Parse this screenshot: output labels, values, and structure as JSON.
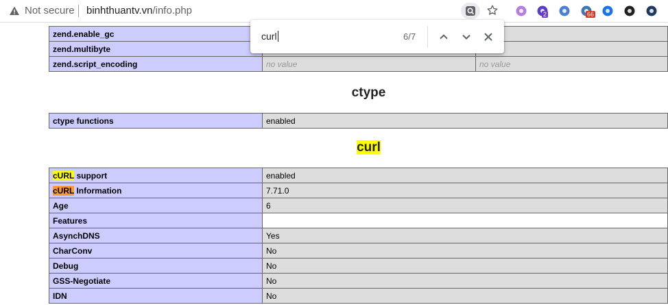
{
  "browser": {
    "security_label": "Not secure",
    "url_domain": "binhthuantv.vn",
    "url_path": "/info.php",
    "extensions": [
      {
        "name": "extension-purple-flower-icon",
        "color": "#b57edc",
        "badge": ""
      },
      {
        "name": "extension-stack-icon",
        "color": "#5b3cc4",
        "badge": "2",
        "badge_color": "#6a3dc8"
      },
      {
        "name": "translate-icon",
        "color": "#4a7fd6",
        "badge": ""
      },
      {
        "name": "globe-extension-icon",
        "color": "#3c78b4",
        "badge": "66",
        "badge_color": "#d93025"
      },
      {
        "name": "extension-a-icon",
        "color": "#1a73e8",
        "badge": ""
      },
      {
        "name": "sync-icon",
        "color": "#202124",
        "badge": ""
      },
      {
        "name": "ip-extension-icon",
        "color": "#1f3a60",
        "badge": ""
      }
    ]
  },
  "find_bar": {
    "query": "curl",
    "count": "6/7"
  },
  "zend_rows": [
    {
      "key": "zend.enable_gc",
      "local": "",
      "master": "",
      "no_value": false
    },
    {
      "key": "zend.multibyte",
      "local": "",
      "master": "",
      "no_value": false
    },
    {
      "key": "zend.script_encoding",
      "local": "no value",
      "master": "no value",
      "no_value": true
    }
  ],
  "ctype": {
    "title": "ctype",
    "rows": [
      {
        "key": "ctype functions",
        "value": "enabled"
      }
    ]
  },
  "curl": {
    "title": "curl",
    "support_hl": "cURL",
    "support_rest": " support",
    "support_value": "enabled",
    "info_hl": "cURL",
    "info_rest": " Information",
    "info_value": "7.71.0",
    "rows": [
      {
        "key": "Age",
        "value": "6"
      },
      {
        "key": "Features",
        "value": ""
      },
      {
        "key": "AsynchDNS",
        "value": "Yes"
      },
      {
        "key": "CharConv",
        "value": "No"
      },
      {
        "key": "Debug",
        "value": "No"
      },
      {
        "key": "GSS-Negotiate",
        "value": "No"
      },
      {
        "key": "IDN",
        "value": "No"
      }
    ]
  }
}
